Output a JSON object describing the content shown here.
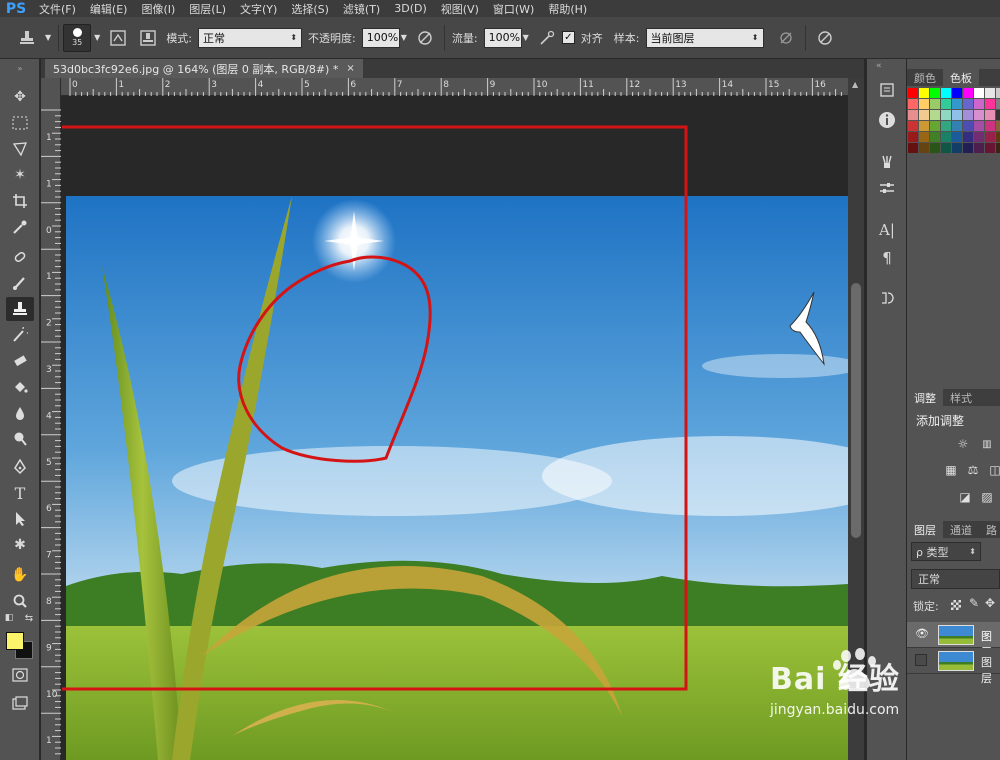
{
  "app": {
    "logo": "PS"
  },
  "menu": [
    "文件(F)",
    "编辑(E)",
    "图像(I)",
    "图层(L)",
    "文字(Y)",
    "选择(S)",
    "滤镜(T)",
    "3D(D)",
    "视图(V)",
    "窗口(W)",
    "帮助(H)"
  ],
  "options": {
    "brush_size": "35",
    "mode_label": "模式:",
    "mode_value": "正常",
    "opacity_label": "不透明度:",
    "opacity_value": "100%",
    "flow_label": "流量:",
    "flow_value": "100%",
    "aligned_label": "对齐",
    "sample_label": "样本:",
    "sample_value": "当前图层"
  },
  "document": {
    "tab_title": "53d0bc3fc92e6.jpg @ 164% (图层 0 副本, RGB/8#) *",
    "close": "×"
  },
  "ruler": {
    "top": [
      "0",
      "1",
      "2",
      "3",
      "4",
      "5",
      "6",
      "7",
      "8",
      "9",
      "10",
      "11",
      "12",
      "13",
      "14",
      "15",
      "16"
    ],
    "left": [
      "1",
      "1",
      "0",
      "1",
      "2",
      "3",
      "4",
      "5",
      "6",
      "7",
      "8",
      "9",
      "10",
      "1"
    ]
  },
  "panels": {
    "color_tab": "颜色",
    "swatches_tab": "色板",
    "adjust_tab": "调整",
    "styles_tab": "样式",
    "add_adjustment": "添加调整",
    "layers_tab": "图层",
    "channels_tab": "通道",
    "paths_tab": "路",
    "kind_filter": "ρ 类型",
    "blend_mode": "正常",
    "lock_label": "锁定:",
    "layers": [
      {
        "name": "图层",
        "visible": true
      },
      {
        "name": "图层",
        "visible": false
      }
    ]
  },
  "watermark": {
    "brand": "Bai 经验",
    "url": "jingyan.baidu.com"
  },
  "colors": {
    "foreground": "#fbf46a",
    "background": "#111111",
    "annotation": "#d41414"
  }
}
